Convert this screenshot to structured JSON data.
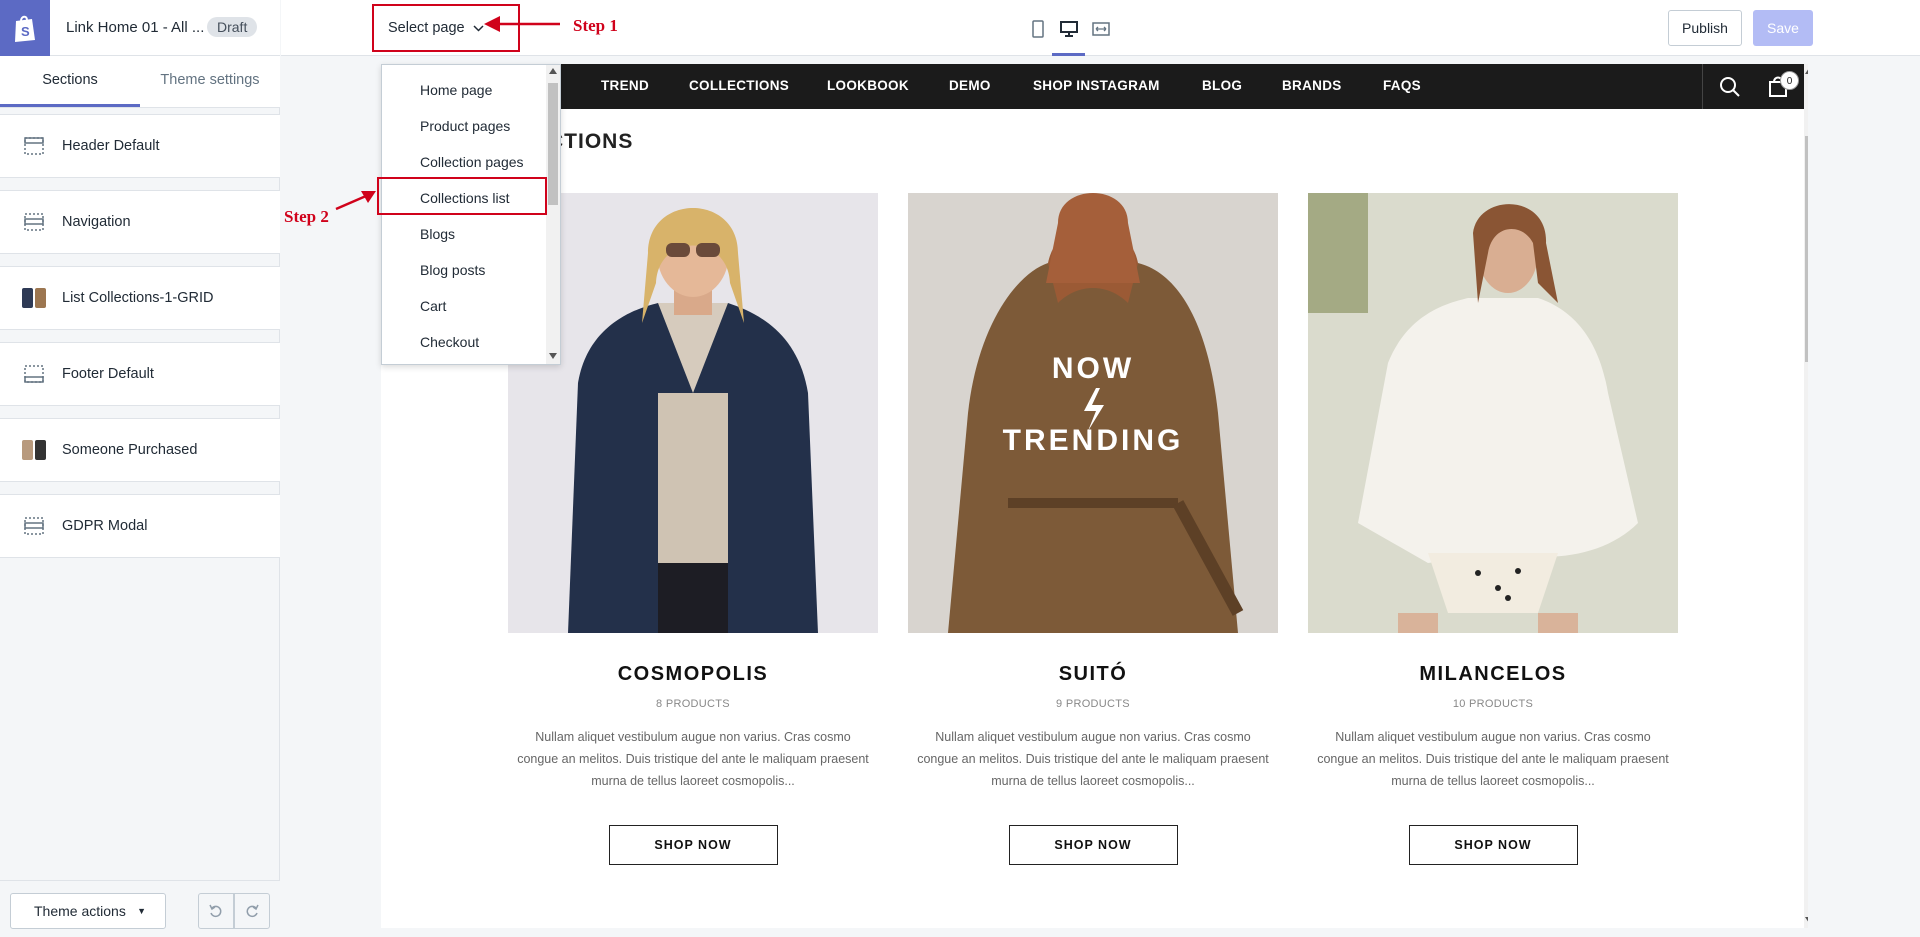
{
  "header": {
    "theme_name": "Link Home 01 - All ...",
    "draft_badge": "Draft",
    "select_page": "Select page",
    "publish": "Publish",
    "save": "Save"
  },
  "annotations": {
    "step1": "Step 1",
    "step2": "Step 2",
    "color": "#d0021b"
  },
  "tabs": [
    "Sections",
    "Theme settings"
  ],
  "sections": [
    {
      "label": "Header Default",
      "icon": "section-icon"
    },
    {
      "label": "Navigation",
      "icon": "section-icon"
    },
    {
      "label": "List Collections-1-GRID",
      "icon": "thumbnail"
    },
    {
      "label": "Footer Default",
      "icon": "section-icon"
    },
    {
      "label": "Someone Purchased",
      "icon": "thumbnail"
    },
    {
      "label": "GDPR Modal",
      "icon": "section-icon"
    }
  ],
  "footer": {
    "theme_actions": "Theme actions"
  },
  "dropdown": {
    "items": [
      "Home page",
      "Product pages",
      "Collection pages",
      "Collections list",
      "Blogs",
      "Blog posts",
      "Cart",
      "Checkout"
    ],
    "highlighted": "Collections list"
  },
  "store": {
    "nav": [
      "TREND",
      "COLLECTIONS",
      "LOOKBOOK",
      "DEMO",
      "SHOP INSTAGRAM",
      "BLOG",
      "BRANDS",
      "FAQS"
    ],
    "cart_count": "0",
    "heading": "ECTIONS",
    "trend_overlay": [
      "NOW",
      "TRENDING"
    ],
    "collections": [
      {
        "title": "COSMOPOLIS",
        "count": "8 PRODUCTS",
        "desc": "Nullam aliquet vestibulum augue non varius. Cras cosmo congue an melitos. Duis tristique del ante le maliquam praesent murna de tellus laoreet cosmopolis...",
        "button": "SHOP NOW"
      },
      {
        "title": "SUITÓ",
        "count": "9 PRODUCTS",
        "desc": "Nullam aliquet vestibulum augue non varius. Cras cosmo congue an melitos. Duis tristique del ante le maliquam praesent murna de tellus laoreet cosmopolis...",
        "button": "SHOP NOW"
      },
      {
        "title": "MILANCELOS",
        "count": "10 PRODUCTS",
        "desc": "Nullam aliquet vestibulum augue non varius. Cras cosmo congue an melitos. Duis tristique del ante le maliquam praesent murna de tellus laoreet cosmopolis...",
        "button": "SHOP NOW"
      }
    ]
  },
  "colors": {
    "accent": "#5c6ac4",
    "save_disabled": "#b3bcf5",
    "store_nav": "#1b1b1b"
  }
}
